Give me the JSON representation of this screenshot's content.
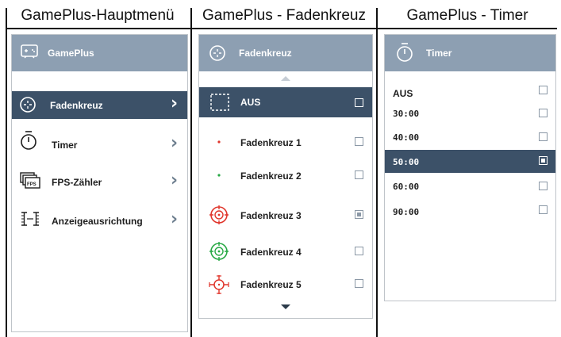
{
  "columns": {
    "menu_title": "GamePlus-Hauptmenü",
    "crosshair_title": "GamePlus - Fadenkreuz",
    "timer_title": "GamePlus - Timer"
  },
  "main_menu": {
    "header": "GamePlus",
    "header_icon": "gamepad-icon",
    "items": [
      {
        "label": "Fadenkreuz",
        "icon": "crosshair-icon",
        "selected": true
      },
      {
        "label": "Timer",
        "icon": "stopwatch-icon",
        "selected": false
      },
      {
        "label": "FPS-Zähler",
        "icon": "fps-counter-icon",
        "selected": false
      },
      {
        "label": "Anzeigeausrichtung",
        "icon": "display-alignment-icon",
        "selected": false
      }
    ]
  },
  "crosshair_menu": {
    "header": "Fadenkreuz",
    "header_icon": "crosshair-icon",
    "items": [
      {
        "label": "AUS",
        "icon": "dashed-frame-icon",
        "selected": true,
        "checked": false
      },
      {
        "label": "Fadenkreuz 1",
        "icon": "red-dot-icon",
        "selected": false,
        "checked": false
      },
      {
        "label": "Fadenkreuz 2",
        "icon": "green-dot-icon",
        "selected": false,
        "checked": false
      },
      {
        "label": "Fadenkreuz 3",
        "icon": "red-target-icon",
        "selected": false,
        "checked": true
      },
      {
        "label": "Fadenkreuz 4",
        "icon": "green-target-icon",
        "selected": false,
        "checked": false
      },
      {
        "label": "Fadenkreuz 5",
        "icon": "red-crosshair-icon",
        "selected": false,
        "checked": false
      }
    ]
  },
  "timer_menu": {
    "header": "Timer",
    "header_icon": "stopwatch-icon",
    "items": [
      {
        "label": "AUS",
        "selected": false,
        "checked": false
      },
      {
        "label": "30:00",
        "selected": false,
        "checked": false
      },
      {
        "label": "40:00",
        "selected": false,
        "checked": false
      },
      {
        "label": "50:00",
        "selected": true,
        "checked": true
      },
      {
        "label": "60:00",
        "selected": false,
        "checked": false
      },
      {
        "label": "90:00",
        "selected": false,
        "checked": false
      }
    ]
  },
  "colors": {
    "header_bg": "#8d9fb2",
    "selected_bg": "#3c5168",
    "crosshair_red": "#e0352b",
    "crosshair_green": "#27a844"
  }
}
